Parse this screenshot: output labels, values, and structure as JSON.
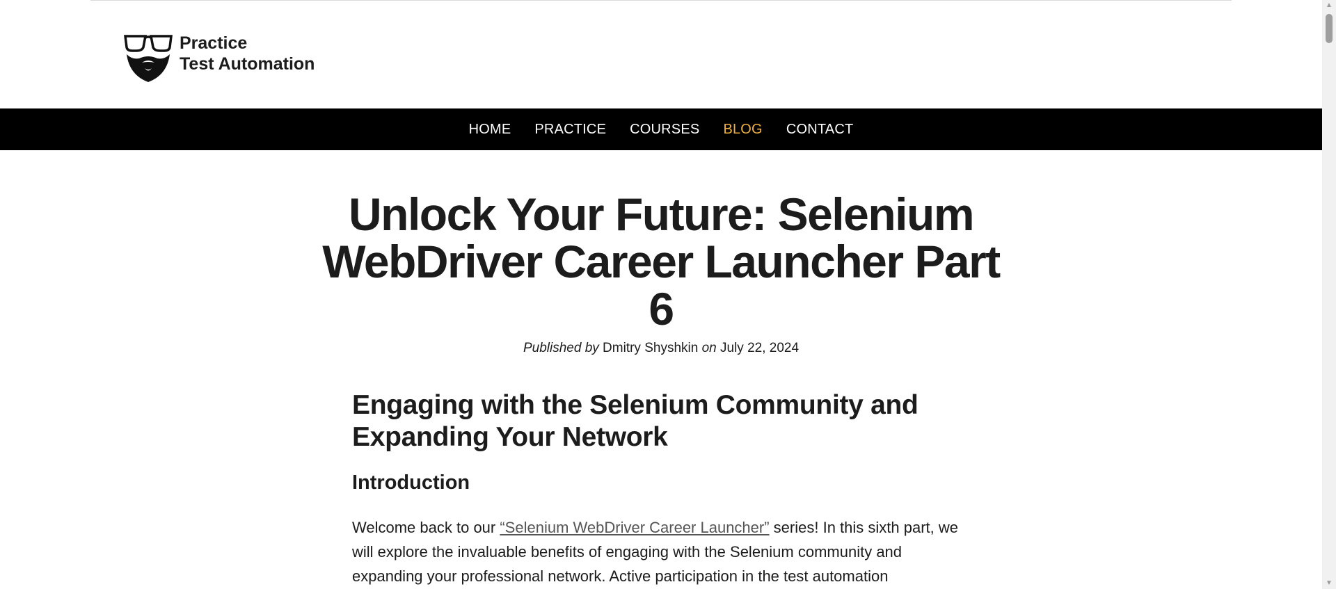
{
  "header": {
    "logo_line1": "Practice",
    "logo_line2": "Test Automation"
  },
  "nav": {
    "items": [
      {
        "label": "HOME"
      },
      {
        "label": "PRACTICE"
      },
      {
        "label": "COURSES"
      },
      {
        "label": "BLOG",
        "active": true
      },
      {
        "label": "CONTACT"
      }
    ],
    "active_color": "#f0b040"
  },
  "post": {
    "title": "Unlock Your Future: Selenium WebDriver Career Launcher Part 6",
    "meta": {
      "published_by": "Published by",
      "author": "Dmitry Shyshkin",
      "on": "on",
      "date": "July 22, 2024"
    },
    "section_heading": "Engaging with the Selenium Community and Expanding Your Network",
    "intro_heading": "Introduction",
    "intro": {
      "before_link": "Welcome back to our ",
      "link_text": "“Selenium WebDriver Career Launcher”",
      "after_link": " series! In this sixth part, we will explore the invaluable benefits of engaging with the Selenium community and expanding your professional network. Active participation in the test automation"
    }
  }
}
